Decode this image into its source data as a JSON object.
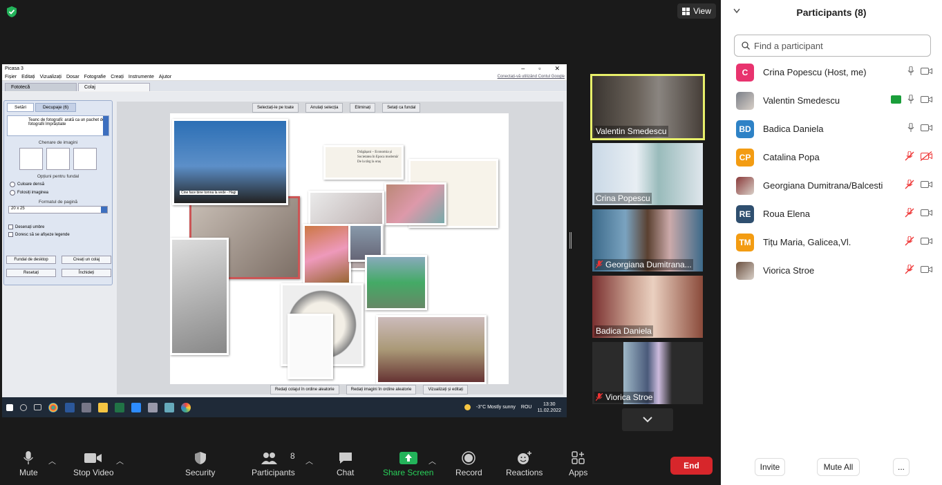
{
  "meeting": {
    "view_label": "View"
  },
  "shared_app": {
    "title": "Picasa 3",
    "menu": [
      "Fișier",
      "Editați",
      "Vizualizați",
      "Dosar",
      "Fotografie",
      "Creați",
      "Instrumente",
      "Ajutor"
    ],
    "account_link": "Conectați-vă utilizând Contul Google",
    "tabs": [
      "Fototecă",
      "Colaj"
    ],
    "side_tabs": [
      "Setări",
      "Decupaje (6)"
    ],
    "stack_option": "Teanc de fotografii: arată ca un pachet de fotografii împrăștiate",
    "frames_heading": "Chenare de imagini",
    "bg_heading": "Opțiuni pentru fundal",
    "bg_solid": "Culoare densă",
    "bg_image": "Folosiți imaginea",
    "page_format_heading": "Formatul de pagină",
    "page_format_value": "20 x 25",
    "draw_shadows": "Desenați umbre",
    "show_captions": "Doresc să se afișeze legende",
    "btn_desktop_bg": "Fundal de desktop",
    "btn_create_collage": "Creați un colaj",
    "btn_reset": "Resetați",
    "btn_close": "Închideți",
    "top_buttons": [
      "Selectați-le pe toate",
      "Anulați selecția",
      "Eliminați",
      "Setați ca fundal"
    ],
    "bottom_buttons": [
      "Redați colajul în ordine aleatorie",
      "Redați imagini în ordine aleatorie",
      "Vizualizați și editați"
    ],
    "collage_texts": {
      "banner_title": "Drăgășani – Economia și Societatea în Epoca modernă/ De la târg la oraș",
      "caption_video": "Cine face bine tomna la vede - Hagi"
    },
    "taskbar": {
      "weather": "-3°C  Mostly sunny",
      "lang": "ROU",
      "time": "13:30",
      "date": "11.02.2022"
    }
  },
  "video_tiles": [
    {
      "name": "Valentin Smedescu",
      "muted": false,
      "speaking": true
    },
    {
      "name": "Crina Popescu",
      "muted": false,
      "speaking": false
    },
    {
      "name": "Georgiana Dumitrana...",
      "muted": true,
      "speaking": false
    },
    {
      "name": "Badica Daniela",
      "muted": false,
      "speaking": false
    },
    {
      "name": "Viorica Stroe",
      "muted": true,
      "speaking": false
    }
  ],
  "toolbar": {
    "mute": "Mute",
    "stop_video": "Stop Video",
    "security": "Security",
    "participants": "Participants",
    "participants_count": "8",
    "chat": "Chat",
    "share_screen": "Share Screen",
    "record": "Record",
    "reactions": "Reactions",
    "apps": "Apps",
    "end": "End"
  },
  "panel": {
    "title": "Participants (8)",
    "search_placeholder": "Find a participant",
    "participants": [
      {
        "name": "Crina Popescu (Host, me)",
        "initials": "C",
        "color": "#e8336e",
        "muted": false,
        "video_off": false,
        "sharing": false,
        "photo": false
      },
      {
        "name": "Valentin Smedescu",
        "initials": "",
        "color": "#7a7f88",
        "muted": false,
        "video_off": false,
        "sharing": true,
        "photo": true
      },
      {
        "name": "Badica Daniela",
        "initials": "BD",
        "color": "#2e82c6",
        "muted": false,
        "video_off": false,
        "sharing": false,
        "photo": false
      },
      {
        "name": "Catalina Popa",
        "initials": "CP",
        "color": "#f39c12",
        "muted": true,
        "video_off": true,
        "sharing": false,
        "photo": false
      },
      {
        "name": "Georgiana Dumitrana/Balcesti",
        "initials": "",
        "color": "#8a3a3a",
        "muted": true,
        "video_off": false,
        "sharing": false,
        "photo": true
      },
      {
        "name": "Roua Elena",
        "initials": "RE",
        "color": "#2f4f6f",
        "muted": true,
        "video_off": false,
        "sharing": false,
        "photo": false
      },
      {
        "name": "Tițu Maria, Galicea,Vl.",
        "initials": "TM",
        "color": "#f39c12",
        "muted": true,
        "video_off": false,
        "sharing": false,
        "photo": false
      },
      {
        "name": "Viorica Stroe",
        "initials": "",
        "color": "#6a5040",
        "muted": true,
        "video_off": false,
        "sharing": false,
        "photo": true
      }
    ],
    "invite": "Invite",
    "mute_all": "Mute All",
    "more": "..."
  }
}
